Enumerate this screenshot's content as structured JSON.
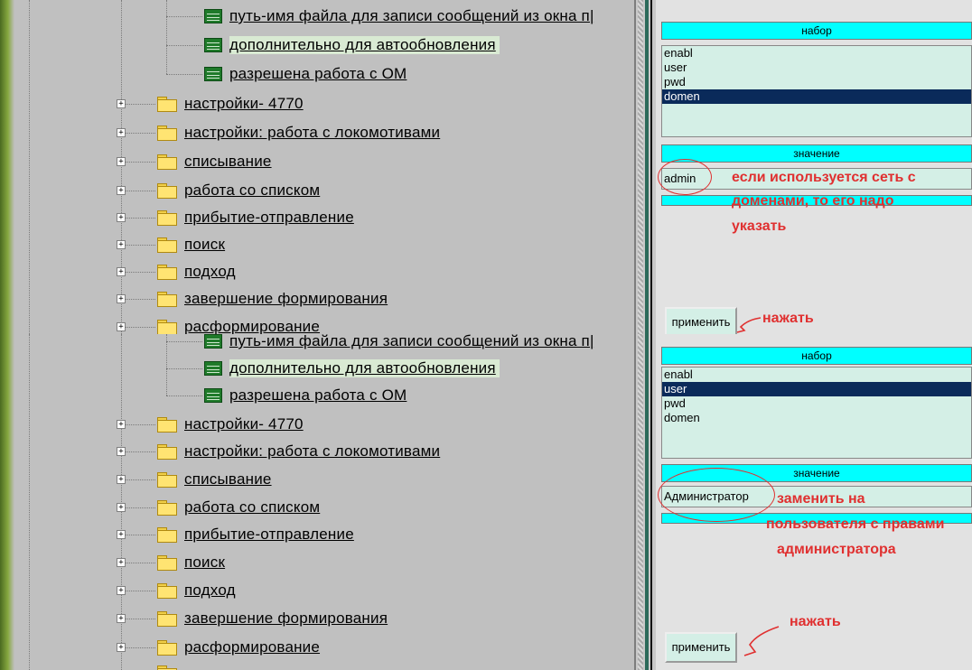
{
  "tree": {
    "leaf_items": [
      {
        "label": "путь-имя файла для записи сообщений из окна п|"
      },
      {
        "label": "дополнительно для автообновления"
      },
      {
        "label": "разрешена работа с ОМ"
      }
    ],
    "folder_items_top": [
      {
        "label": "настройки- 4770"
      },
      {
        "label": "настройки: работа с локомотивами"
      },
      {
        "label": "списывание"
      },
      {
        "label": "работа со списком"
      },
      {
        "label": "прибытие-отправление"
      },
      {
        "label": "поиск"
      },
      {
        "label": "подход"
      },
      {
        "label": "завершение формирования"
      },
      {
        "label": "расформирование"
      }
    ],
    "folder_items_bottom": [
      {
        "label": "настройки- 4770"
      },
      {
        "label": "настройки: работа с локомотивами"
      },
      {
        "label": "списывание"
      },
      {
        "label": "работа со списком"
      },
      {
        "label": "прибытие-отправление"
      },
      {
        "label": "поиск"
      },
      {
        "label": "подход"
      },
      {
        "label": "завершение формирования"
      },
      {
        "label": "расформирование"
      }
    ],
    "expander_glyph": "+"
  },
  "top_panel": {
    "set_header": "набор",
    "list_items": [
      "enabl",
      "user",
      "pwd",
      "domen"
    ],
    "selected_index": 3,
    "value_header": "значение",
    "value": "admin",
    "apply_button": "применить",
    "note_value": [
      "если используется сеть с",
      "доменами, то его надо",
      "указать"
    ],
    "note_apply": "нажать"
  },
  "bottom_panel": {
    "set_header": "набор",
    "list_items": [
      "enabl",
      "user",
      "pwd",
      "domen"
    ],
    "selected_index": 1,
    "value_header": "значение",
    "value": "Администратор",
    "apply_button": "применить",
    "note_value": [
      "заменить на",
      "пользователя с правами",
      "администратора"
    ],
    "note_apply": "нажать"
  },
  "colors": {
    "tree_bg": "#c0c0c0",
    "cyan": "#00ffff",
    "selected": "#0a2a5a",
    "annotation": "#e03030"
  }
}
